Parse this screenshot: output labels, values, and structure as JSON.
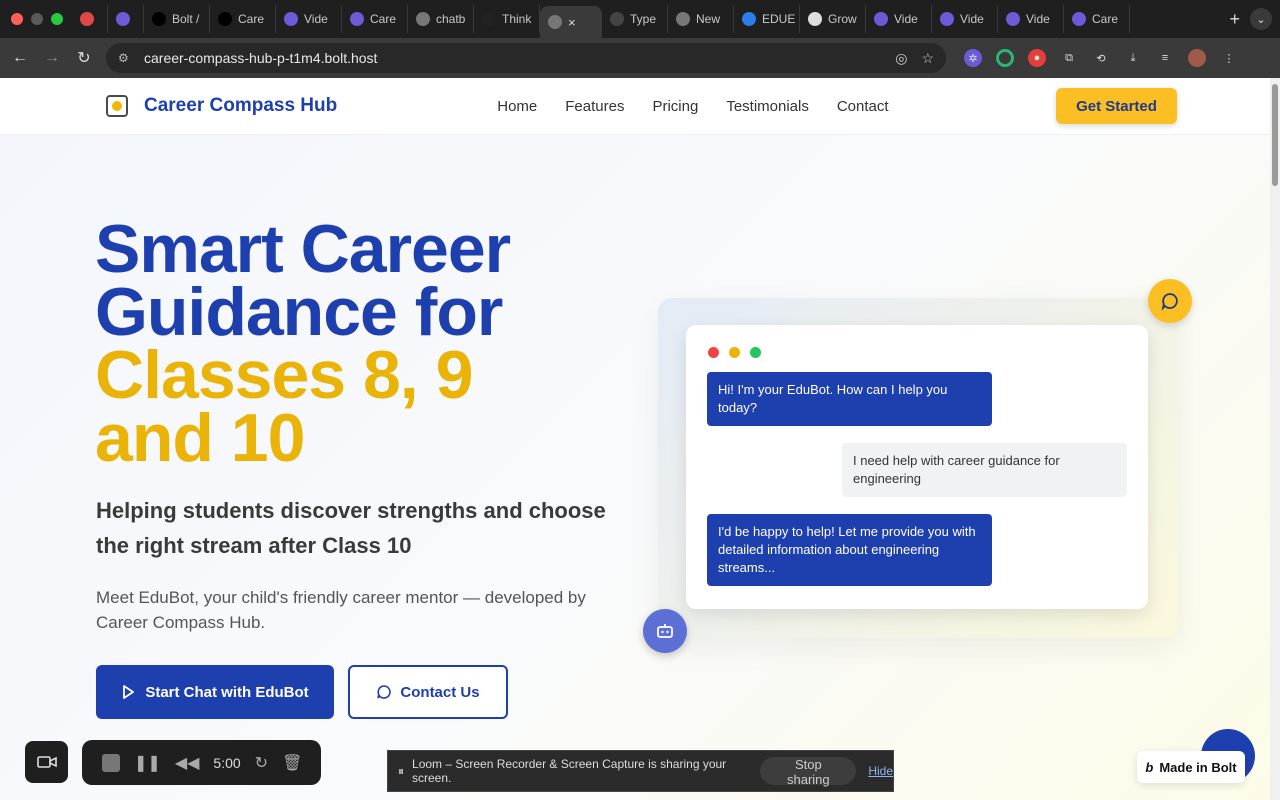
{
  "browser": {
    "tabs": [
      {
        "label": "",
        "icon": "record-icon",
        "color": "#e04848"
      },
      {
        "label": "",
        "icon": "gear-icon",
        "color": "#6b5bd6"
      },
      {
        "label": "Bolt /",
        "icon": "bolt-icon",
        "color": "#000000"
      },
      {
        "label": "Care",
        "icon": "bolt-icon",
        "color": "#000000"
      },
      {
        "label": "Vide",
        "icon": "gear-icon",
        "color": "#6b5bd6"
      },
      {
        "label": "Care",
        "icon": "gear-icon",
        "color": "#6b5bd6"
      },
      {
        "label": "chatb",
        "icon": "globe-icon",
        "color": "#777777"
      },
      {
        "label": "Think",
        "icon": "t-icon",
        "color": "#222222"
      },
      {
        "label": "",
        "icon": "globe-icon",
        "color": "#777777",
        "active": true
      },
      {
        "label": "Type",
        "icon": "openai-icon",
        "color": "#444444"
      },
      {
        "label": "New",
        "icon": "globe-icon",
        "color": "#777777"
      },
      {
        "label": "EDUE",
        "icon": "c-icon",
        "color": "#2b7de9"
      },
      {
        "label": "Grow",
        "icon": "doc-icon",
        "color": "#dddddd"
      },
      {
        "label": "Vide",
        "icon": "gear-icon",
        "color": "#6b5bd6"
      },
      {
        "label": "Vide",
        "icon": "gear-icon",
        "color": "#6b5bd6"
      },
      {
        "label": "Vide",
        "icon": "gear-icon",
        "color": "#6b5bd6"
      },
      {
        "label": "Care",
        "icon": "gear-icon",
        "color": "#6b5bd6"
      }
    ],
    "url": "career-compass-hub-p-t1m4.bolt.host"
  },
  "site": {
    "brand": "Career Compass Hub",
    "nav": [
      "Home",
      "Features",
      "Pricing",
      "Testimonials",
      "Contact"
    ],
    "cta": "Get Started"
  },
  "hero": {
    "title_line1": "Smart Career",
    "title_line2": "Guidance for",
    "title_line3": "Classes 8, 9",
    "title_line4": "and 10",
    "subtitle": "Helping students discover strengths and choose the right stream after Class 10",
    "description": "Meet EduBot, your child's friendly career mentor — developed by Career Compass Hub.",
    "primary_button": "Start Chat with EduBot",
    "secondary_button": "Contact Us"
  },
  "chat": {
    "messages": [
      {
        "from": "bot",
        "text": "Hi! I'm your EduBot. How can I help you today?"
      },
      {
        "from": "user",
        "text": "I need help with career guidance for engineering"
      },
      {
        "from": "bot",
        "text": "I'd be happy to help! Let me provide you with detailed information about engineering streams..."
      }
    ]
  },
  "loom": {
    "timer": "5:00",
    "share_message": "Loom – Screen Recorder & Screen Capture is sharing your screen.",
    "stop_label": "Stop sharing",
    "hide_label": "Hide"
  },
  "badge": {
    "label": "Made in Bolt"
  },
  "colors": {
    "primary": "#1e3fae",
    "accent": "#fbbf24",
    "gold_text": "#eab308"
  }
}
